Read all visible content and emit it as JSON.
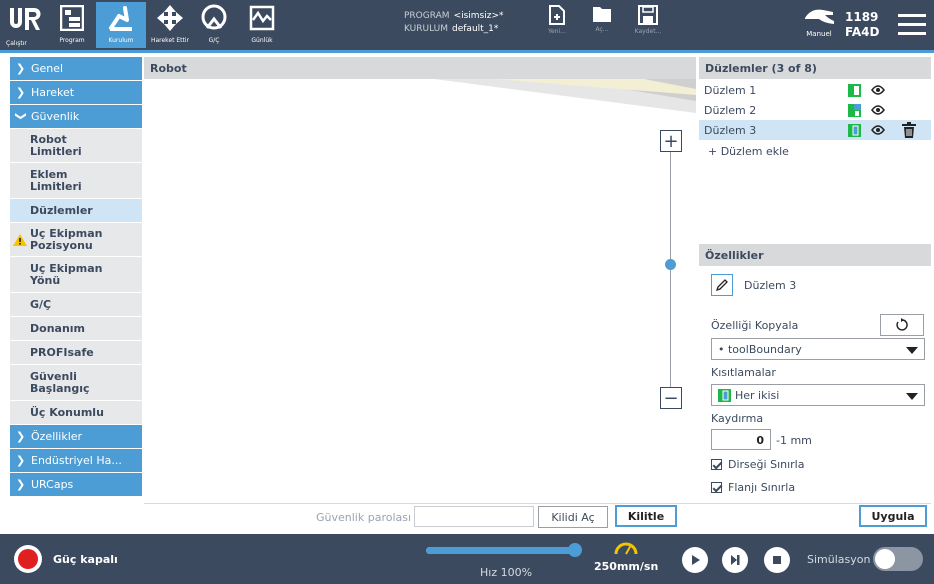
{
  "topbar": {
    "tabs": [
      {
        "label": "Çalıştır",
        "icon": "ur-logo-icon"
      },
      {
        "label": "Program",
        "icon": "program-icon"
      },
      {
        "label": "Kurulum",
        "icon": "installation-icon"
      },
      {
        "label": "Hareket Ettir",
        "icon": "move-icon"
      },
      {
        "label": "G/Ç",
        "icon": "io-icon"
      },
      {
        "label": "Günlük",
        "icon": "log-icon"
      }
    ],
    "program_label": "PROGRAM",
    "program_value": "<isimsiz>*",
    "installation_label": "KURULUM",
    "installation_value": "default_1*",
    "file_buttons": [
      {
        "label": "Yeni...",
        "icon": "new-file-icon"
      },
      {
        "label": "Aç...",
        "icon": "folder-icon"
      },
      {
        "label": "Kaydet...",
        "icon": "save-icon"
      }
    ],
    "mode_label": "Manuel",
    "counter_line1": "1189",
    "counter_line2": "FA4D"
  },
  "nav": {
    "sections_top": [
      "Genel",
      "Hareket",
      "Güvenlik"
    ],
    "safety_items": [
      {
        "label": "Robot Limitleri",
        "lines": [
          "Robot",
          "Limitleri"
        ]
      },
      {
        "label": "Eklem Limitleri",
        "lines": [
          "Eklem",
          "Limitleri"
        ]
      },
      {
        "label": "Düzlemler",
        "lines": [
          "Düzlemler"
        ],
        "selected": true
      },
      {
        "label": "Uç Ekipman Pozisyonu",
        "lines": [
          "Uç Ekipman",
          "Pozisyonu"
        ],
        "warning": true
      },
      {
        "label": "Uç Ekipman Yönü",
        "lines": [
          "Uç Ekipman",
          "Yönü"
        ]
      },
      {
        "label": "G/Ç",
        "lines": [
          "G/Ç"
        ]
      },
      {
        "label": "Donanım",
        "lines": [
          "Donanım"
        ]
      },
      {
        "label": "PROFIsafe",
        "lines": [
          "PROFIsafe"
        ]
      },
      {
        "label": "Güvenli Başlangıç",
        "lines": [
          "Güvenli",
          "Başlangıç"
        ]
      },
      {
        "label": "Üç Konumlu",
        "lines": [
          "Üç Konumlu"
        ]
      }
    ],
    "sections_bottom": [
      "Özellikler",
      "Endüstriyel Ha...",
      "URCaps"
    ]
  },
  "robot_panel": {
    "title": "Robot",
    "zoom_in": "+",
    "zoom_out": "−"
  },
  "planes": {
    "header": "Düzlemler (3 of 8)",
    "items": [
      "Düzlem 1",
      "Düzlem 2",
      "Düzlem 3"
    ],
    "add_label": "+ Düzlem ekle"
  },
  "properties": {
    "header": "Özellikler",
    "name": "Düzlem 3",
    "copy_label": "Özelliği Kopyala",
    "copy_select": "• toolBoundary",
    "restrictions_label": "Kısıtlamalar",
    "restrictions_select": "Her ikisi",
    "offset_label": "Kaydırma",
    "offset_value": "0",
    "offset_unit": "-1 mm",
    "elbow_label": "Dirseği Sınırla",
    "flange_label": "Flanjı Sınırla"
  },
  "safety_bar": {
    "password_label": "Güvenlik parolası",
    "unlock": "Kilidi Aç",
    "lock": "Kilitle",
    "apply": "Uygula"
  },
  "footer": {
    "power_label": "Güç kapalı",
    "speed_label": "Hız 100%",
    "speed_fraction": 1.0,
    "tcp_speed": "250mm/sn",
    "sim_label": "Simülasyon"
  },
  "colors": {
    "topbar": "#3c4a5f",
    "accent": "#4c9dd6",
    "selected": "#cfe4f5",
    "nav_item": "#e7e8ea",
    "power_red": "#e02020",
    "plane_green": "#1db84a"
  }
}
